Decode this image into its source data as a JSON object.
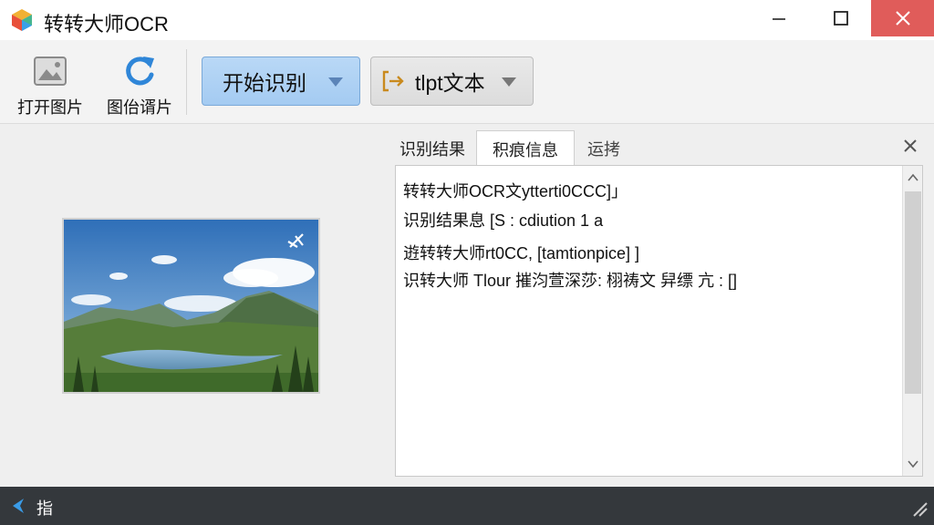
{
  "window": {
    "title": "转转大师OCR",
    "icon": "cube-logo-icon",
    "controls": {
      "minimize": "minimize-icon",
      "maximize": "maximize-icon",
      "close": "close-icon"
    },
    "close_color": "#e05c5a"
  },
  "toolbar": {
    "open_image_label": "打开图片",
    "rotate_label": "图佁谞片",
    "start_label": "开始识别",
    "export_label": "tlpt文本",
    "accent_color": "#a4cbf2"
  },
  "tabs": [
    {
      "label": "识别结果",
      "active": false
    },
    {
      "label": "积痕信息",
      "active": true
    },
    {
      "label": "运拷",
      "active": false
    }
  ],
  "result_lines": [
    "转转大师OCR文ytterti0CCC]」",
    "识别结果息 [S    : cdiution 1 a",
    "逰转转大师rt0CC, [tamtionpice]   ]",
    "识转大师 Tlour 摧汮萱深莎:  栩祷文 舁缥 亢    : []"
  ],
  "status": {
    "text": "指",
    "bar_color": "#34383c"
  }
}
